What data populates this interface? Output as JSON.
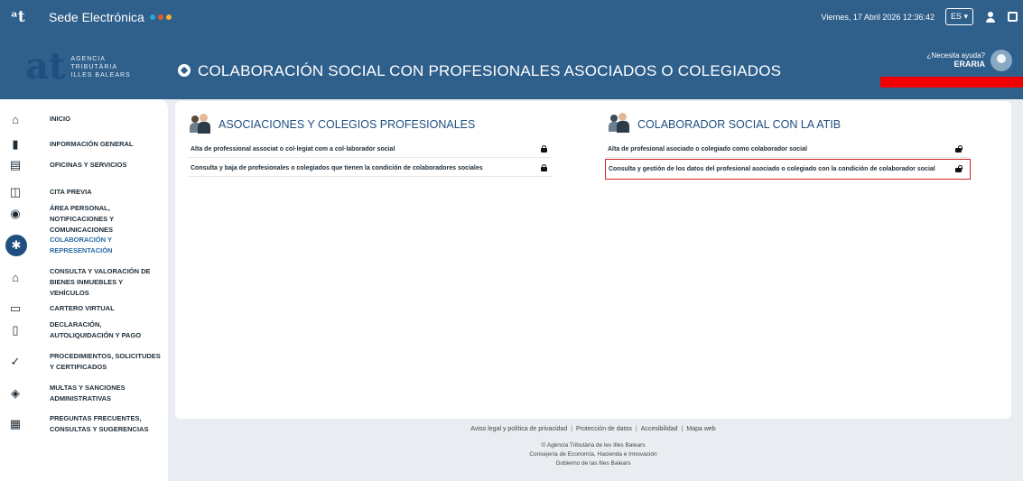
{
  "topbar": {
    "app_title": "Sede Electrónica",
    "dot_colors": [
      "#2aa7d8",
      "#e35a2e",
      "#f3b32b"
    ],
    "datetime": "Viernes, 17 Abril 2026 12:36:42",
    "language": "ES ▾"
  },
  "header": {
    "brand_lines": [
      "AGENCIA",
      "TRIBUTÀRIA",
      "ILLES BALEARS"
    ],
    "page_title": "COLABORACIÓN SOCIAL CON PROFESIONALES ASOCIADOS O COLEGIADOS",
    "help_question": "¿Necesita ayuda?",
    "help_name": "ERARIA"
  },
  "sidebar": {
    "items": [
      {
        "label": "INICIO",
        "icon": "home-icon",
        "glyph": "⌂"
      },
      {
        "label": "INFORMACIÓN GENERAL",
        "icon": "book-icon",
        "glyph": "▮"
      },
      {
        "label": "OFICINAS Y SERVICIOS",
        "icon": "building-icon",
        "glyph": "▤"
      },
      {
        "label": "CITA PREVIA",
        "icon": "calendar-icon",
        "glyph": "◫"
      },
      {
        "label": "ÁREA PERSONAL, NOTIFICACIONES Y COMUNICACIONES",
        "icon": "user-circle-icon",
        "glyph": "◉"
      },
      {
        "label": "COLABORACIÓN Y REPRESENTACIÓN",
        "icon": "puzzle-icon",
        "glyph": "✱",
        "active": true
      },
      {
        "label": "CONSULTA Y VALORACIÓN DE BIENES INMUEBLES Y VEHÍCULOS",
        "icon": "property-icon",
        "glyph": "⌂"
      },
      {
        "label": "CARTERO VIRTUAL",
        "icon": "laptop-icon",
        "glyph": "▭"
      },
      {
        "label": "DECLARACIÓN, AUTOLIQUIDACIÓN Y PAGO",
        "icon": "document-icon",
        "glyph": "▯"
      },
      {
        "label": "PROCEDIMIENTOS, SOLICITUDES Y CERTIFICADOS",
        "icon": "check-circle-icon",
        "glyph": "✓"
      },
      {
        "label": "MULTAS Y SANCIONES ADMINISTRATIVAS",
        "icon": "shield-icon",
        "glyph": "◈"
      },
      {
        "label": "PREGUNTAS FRECUENTES, CONSULTAS Y SUGERENCIAS",
        "icon": "faq-icon",
        "glyph": "▦"
      }
    ]
  },
  "left_section": {
    "title": "ASOCIACIONES Y COLEGIOS PROFESIONALES",
    "rows": [
      {
        "label": "Alta de professional associat o col·legiat com a col·laborador social",
        "lock": "closed"
      },
      {
        "label": "Consulta y baja de profesionales o colegiados que tienen la condición de colaboradores sociales",
        "lock": "closed"
      }
    ]
  },
  "right_section": {
    "title": "COLABORADOR SOCIAL CON LA ATIB",
    "rows": [
      {
        "label": "Alta de profesional asociado o colegiado como colaborador social",
        "lock": "open"
      },
      {
        "label": "Consulta y gestión de los datos del profesional asociado o colegiado con la condición de colaborador social",
        "lock": "open",
        "highlighted": true
      }
    ]
  },
  "footer": {
    "links": [
      "Aviso legal y política de privacidad",
      "Protección de datos",
      "Accesibilidad",
      "Mapa web"
    ],
    "separator": "|",
    "lines": [
      "© Agència Tributària de les Illes Balears",
      "Consejería de Economía, Hacienda e Innovación",
      "Gobierno de las Illes Balears"
    ]
  }
}
